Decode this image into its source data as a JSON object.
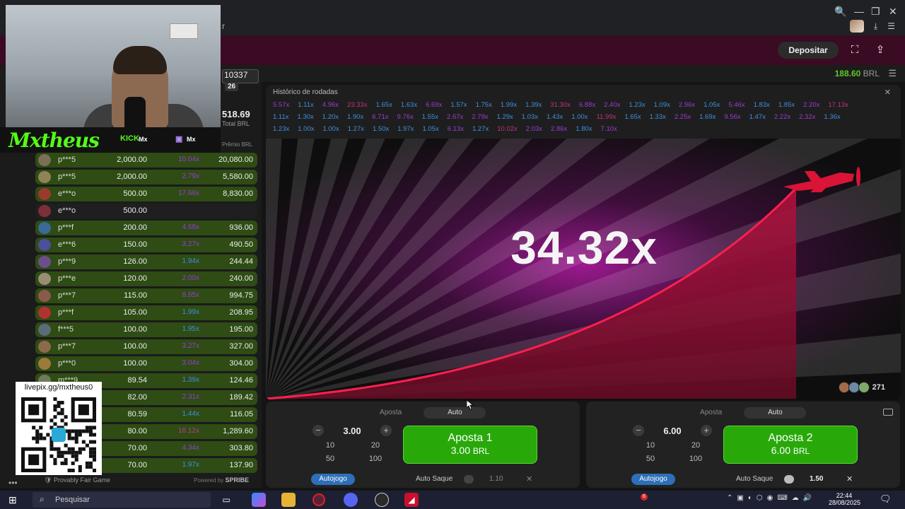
{
  "browser": {
    "tab_fragment": "r",
    "controls": {
      "minimize": "—",
      "restore": "❐",
      "close": "✕"
    }
  },
  "header": {
    "deposit_label": "Depositar"
  },
  "balance": {
    "amount": "188.60",
    "currency": "BRL"
  },
  "left_stats": {
    "count": "10337",
    "count_sub": "26",
    "total": "518.69",
    "total_label": "Total BRL",
    "premio_label": "Prêmio BRL"
  },
  "streamer": {
    "name": "Mxtheus",
    "kick_label": "KICK",
    "kick_handle": "Mx",
    "twitch_handle": "Mx"
  },
  "qr": {
    "label": "livepix.gg/mxtheus0"
  },
  "bets": [
    {
      "user": "p***5",
      "bet": "2,000.00",
      "mult": "10.04x",
      "mult_color": "#9b3bd4",
      "win": "20,080.00",
      "state": "win"
    },
    {
      "user": "p***5",
      "bet": "2,000.00",
      "mult": "2.79x",
      "mult_color": "#9b3bd4",
      "win": "5,580.00",
      "state": "win"
    },
    {
      "user": "e***o",
      "bet": "500.00",
      "mult": "17.66x",
      "mult_color": "#9b3bd4",
      "win": "8,830.00",
      "state": "win"
    },
    {
      "user": "e***o",
      "bet": "500.00",
      "mult": "",
      "mult_color": "#9b3bd4",
      "win": "",
      "state": "plain"
    },
    {
      "user": "p***f",
      "bet": "200.00",
      "mult": "4.68x",
      "mult_color": "#9b3bd4",
      "win": "936.00",
      "state": "win"
    },
    {
      "user": "e***6",
      "bet": "150.00",
      "mult": "3.27x",
      "mult_color": "#9b3bd4",
      "win": "490.50",
      "state": "win"
    },
    {
      "user": "p***9",
      "bet": "126.00",
      "mult": "1.94x",
      "mult_color": "#3d8fe0",
      "win": "244.44",
      "state": "win"
    },
    {
      "user": "p***e",
      "bet": "120.00",
      "mult": "2.00x",
      "mult_color": "#9b3bd4",
      "win": "240.00",
      "state": "win"
    },
    {
      "user": "p***7",
      "bet": "115.00",
      "mult": "8.65x",
      "mult_color": "#9b3bd4",
      "win": "994.75",
      "state": "win"
    },
    {
      "user": "p***f",
      "bet": "105.00",
      "mult": "1.99x",
      "mult_color": "#3d8fe0",
      "win": "208.95",
      "state": "win"
    },
    {
      "user": "f***5",
      "bet": "100.00",
      "mult": "1.95x",
      "mult_color": "#3d8fe0",
      "win": "195.00",
      "state": "win"
    },
    {
      "user": "p***7",
      "bet": "100.00",
      "mult": "3.27x",
      "mult_color": "#9b3bd4",
      "win": "327.00",
      "state": "win"
    },
    {
      "user": "p***0",
      "bet": "100.00",
      "mult": "3.04x",
      "mult_color": "#9b3bd4",
      "win": "304.00",
      "state": "win"
    },
    {
      "user": "m***9",
      "bet": "89.54",
      "mult": "1.39x",
      "mult_color": "#3d8fe0",
      "win": "124.46",
      "state": "win"
    },
    {
      "user": "",
      "bet": "82.00",
      "mult": "2.31x",
      "mult_color": "#9b3bd4",
      "win": "189.42",
      "state": "win"
    },
    {
      "user": "",
      "bet": "80.59",
      "mult": "1.44x",
      "mult_color": "#3d8fe0",
      "win": "116.05",
      "state": "win"
    },
    {
      "user": "",
      "bet": "80.00",
      "mult": "16.12x",
      "mult_color": "#c03b8a",
      "win": "1,289.60",
      "state": "win"
    },
    {
      "user": "",
      "bet": "70.00",
      "mult": "4.34x",
      "mult_color": "#9b3bd4",
      "win": "303.80",
      "state": "win"
    },
    {
      "user": "",
      "bet": "70.00",
      "mult": "1.97x",
      "mult_color": "#3d8fe0",
      "win": "137.90",
      "state": "win"
    }
  ],
  "footer_left": {
    "provably": "Provably Fair Game",
    "powered": "Powered by",
    "spribe": "SPRIBE"
  },
  "history": {
    "title": "Histórico de rodadas",
    "rows": [
      [
        "5.57x",
        "1.11x",
        "4.96x",
        "23.33x",
        "1.65x",
        "1.63x",
        "6.69x",
        "1.57x",
        "1.75x",
        "1.99x",
        "1.39x",
        "31.30x",
        "6.88x",
        "2.40x",
        "1.23x",
        "1.09x",
        "2.96x",
        "1.05x",
        "5.46x",
        "1.83x",
        "1.85x",
        "2.20x",
        "17.13x"
      ],
      [
        "1.11x",
        "1.30x",
        "1.20x",
        "1.90x",
        "6.71x",
        "9.76x",
        "1.55x",
        "2.67x",
        "2.79x",
        "1.29x",
        "1.03x",
        "1.43x",
        "1.00x",
        "11.99x",
        "1.65x",
        "1.33x",
        "2.25x",
        "1.69x",
        "9.56x",
        "1.47x",
        "2.22x",
        "2.32x",
        "1.36x"
      ],
      [
        "1.23x",
        "1.00x",
        "1.00x",
        "1.27x",
        "1.50x",
        "1.97x",
        "1.05x",
        "6.13x",
        "1.27x",
        "10.02x",
        "2.03x",
        "2.86x",
        "1.80x",
        "7.10x"
      ]
    ]
  },
  "game": {
    "multiplier": "34.32x",
    "players": "271"
  },
  "bet1": {
    "tab_bet": "Aposta",
    "tab_auto": "Auto",
    "amount": "3.00",
    "quick": [
      "10",
      "20",
      "50",
      "100"
    ],
    "btn_title": "Aposta 1",
    "btn_amount": "3.00",
    "btn_currency": "BRL",
    "autojogo": "Autojogo",
    "autosaque": "Auto Saque",
    "cashout": "1.10"
  },
  "bet2": {
    "tab_bet": "Aposta",
    "tab_auto": "Auto",
    "amount": "6.00",
    "quick": [
      "10",
      "20",
      "50",
      "100"
    ],
    "btn_title": "Aposta 2",
    "btn_amount": "6.00",
    "btn_currency": "BRL",
    "autojogo": "Autojogo",
    "autosaque": "Auto Saque",
    "cashout": "1.50"
  },
  "taskbar": {
    "search": "Pesquisar",
    "time": "22:44",
    "date": "28/08/2025",
    "badge": "6"
  }
}
